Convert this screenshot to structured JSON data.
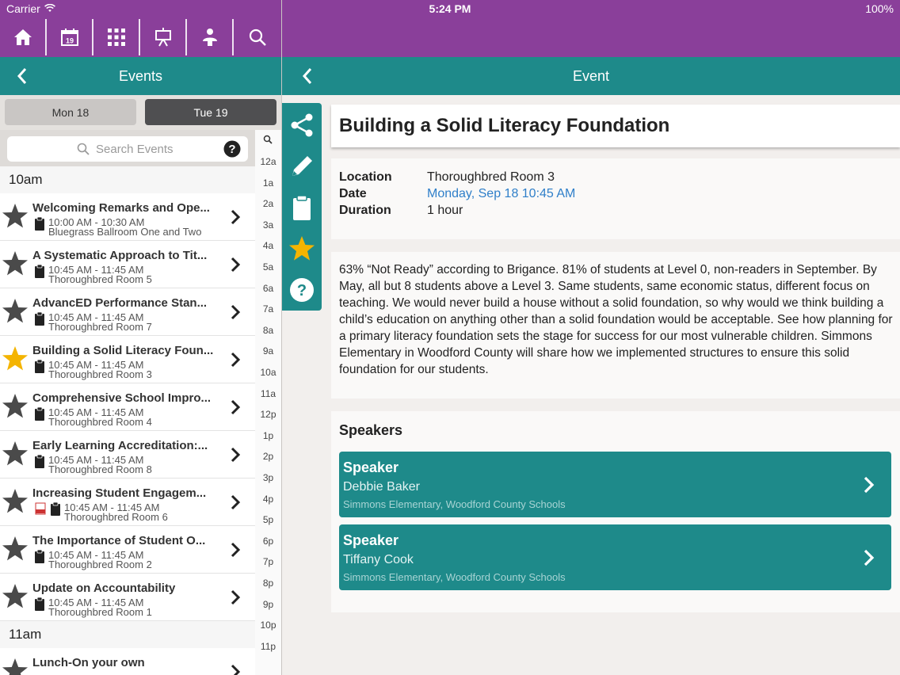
{
  "status_bar": {
    "carrier": "Carrier",
    "time": "5:24 PM",
    "battery": "100%"
  },
  "toolbar": {
    "icons": [
      "home-icon",
      "calendar-icon",
      "grid-icon",
      "presentation-icon",
      "person-icon",
      "search-icon"
    ],
    "calendar_day": "19"
  },
  "left_nav": {
    "title": "Events"
  },
  "right_nav": {
    "title": "Event"
  },
  "day_tabs": [
    {
      "label": "Mon 18",
      "selected": false
    },
    {
      "label": "Tue 19",
      "selected": true
    }
  ],
  "search": {
    "placeholder": "Search Events"
  },
  "time_index": [
    "12a",
    "1a",
    "2a",
    "3a",
    "4a",
    "5a",
    "6a",
    "7a",
    "8a",
    "9a",
    "10a",
    "11a",
    "12p",
    "1p",
    "2p",
    "3p",
    "4p",
    "5p",
    "6p",
    "7p",
    "8p",
    "9p",
    "10p",
    "11p"
  ],
  "hours": [
    "10am",
    "11am"
  ],
  "events": [
    {
      "title": "Welcoming Remarks and Ope...",
      "time": "10:00 AM - 10:30 AM",
      "room": "Bluegrass Ballroom One and Two",
      "favorite": false,
      "pdf": false
    },
    {
      "title": "A Systematic Approach to Tit...",
      "time": "10:45 AM - 11:45 AM",
      "room": "Thoroughbred Room 5",
      "favorite": false,
      "pdf": false
    },
    {
      "title": "AdvancED Performance Stan...",
      "time": "10:45 AM - 11:45 AM",
      "room": "Thoroughbred Room 7",
      "favorite": false,
      "pdf": false
    },
    {
      "title": "Building a Solid Literacy Foun...",
      "time": "10:45 AM - 11:45 AM",
      "room": "Thoroughbred Room 3",
      "favorite": true,
      "pdf": false
    },
    {
      "title": "Comprehensive School Impro...",
      "time": "10:45 AM - 11:45 AM",
      "room": "Thoroughbred Room 4",
      "favorite": false,
      "pdf": false
    },
    {
      "title": "Early Learning Accreditation:...",
      "time": "10:45 AM - 11:45 AM",
      "room": "Thoroughbred Room 8",
      "favorite": false,
      "pdf": false
    },
    {
      "title": "Increasing Student Engagem...",
      "time": "10:45 AM - 11:45 AM",
      "room": "Thoroughbred Room 6",
      "favorite": false,
      "pdf": true
    },
    {
      "title": "The Importance of Student O...",
      "time": "10:45 AM - 11:45 AM",
      "room": "Thoroughbred Room 2",
      "favorite": false,
      "pdf": false
    },
    {
      "title": "Update on Accountability",
      "time": "10:45 AM - 11:45 AM",
      "room": "Thoroughbred Room 1",
      "favorite": false,
      "pdf": false
    },
    {
      "title": "Lunch-On your own",
      "time": "",
      "room": "",
      "favorite": false,
      "pdf": false
    }
  ],
  "actions": [
    "share-icon",
    "pencil-icon",
    "clipboard-icon",
    "star-icon",
    "help-icon"
  ],
  "event": {
    "title": "Building a Solid Literacy Foundation",
    "location_label": "Location",
    "location": "Thoroughbred Room 3",
    "date_label": "Date",
    "date": "Monday, Sep 18 10:45 AM",
    "duration_label": "Duration",
    "duration": "1 hour",
    "description": "63% “Not Ready” according to Brigance. 81% of students at Level 0, non-readers in September.  By May, all but 8 students above a Level 3.  Same students, same economic status, different focus on teaching. We would never build a house without a solid foundation, so why would we think building a child’s education on anything other than a solid foundation would be acceptable. See how planning for a primary literacy foundation sets the stage for success for our most vulnerable children.  Simmons Elementary in Woodford County will share how we implemented structures to ensure this solid foundation for our students."
  },
  "speakers": {
    "heading": "Speakers",
    "items": [
      {
        "role": "Speaker",
        "name": "Debbie Baker",
        "org": "Simmons Elementary, Woodford County Schools"
      },
      {
        "role": "Speaker",
        "name": "Tiffany Cook",
        "org": "Simmons Elementary, Woodford County Schools"
      }
    ]
  },
  "colors": {
    "purple": "#8a3f9a",
    "teal": "#1e8a8a",
    "favorite": "#f4b400",
    "link": "#2f7fc9"
  }
}
